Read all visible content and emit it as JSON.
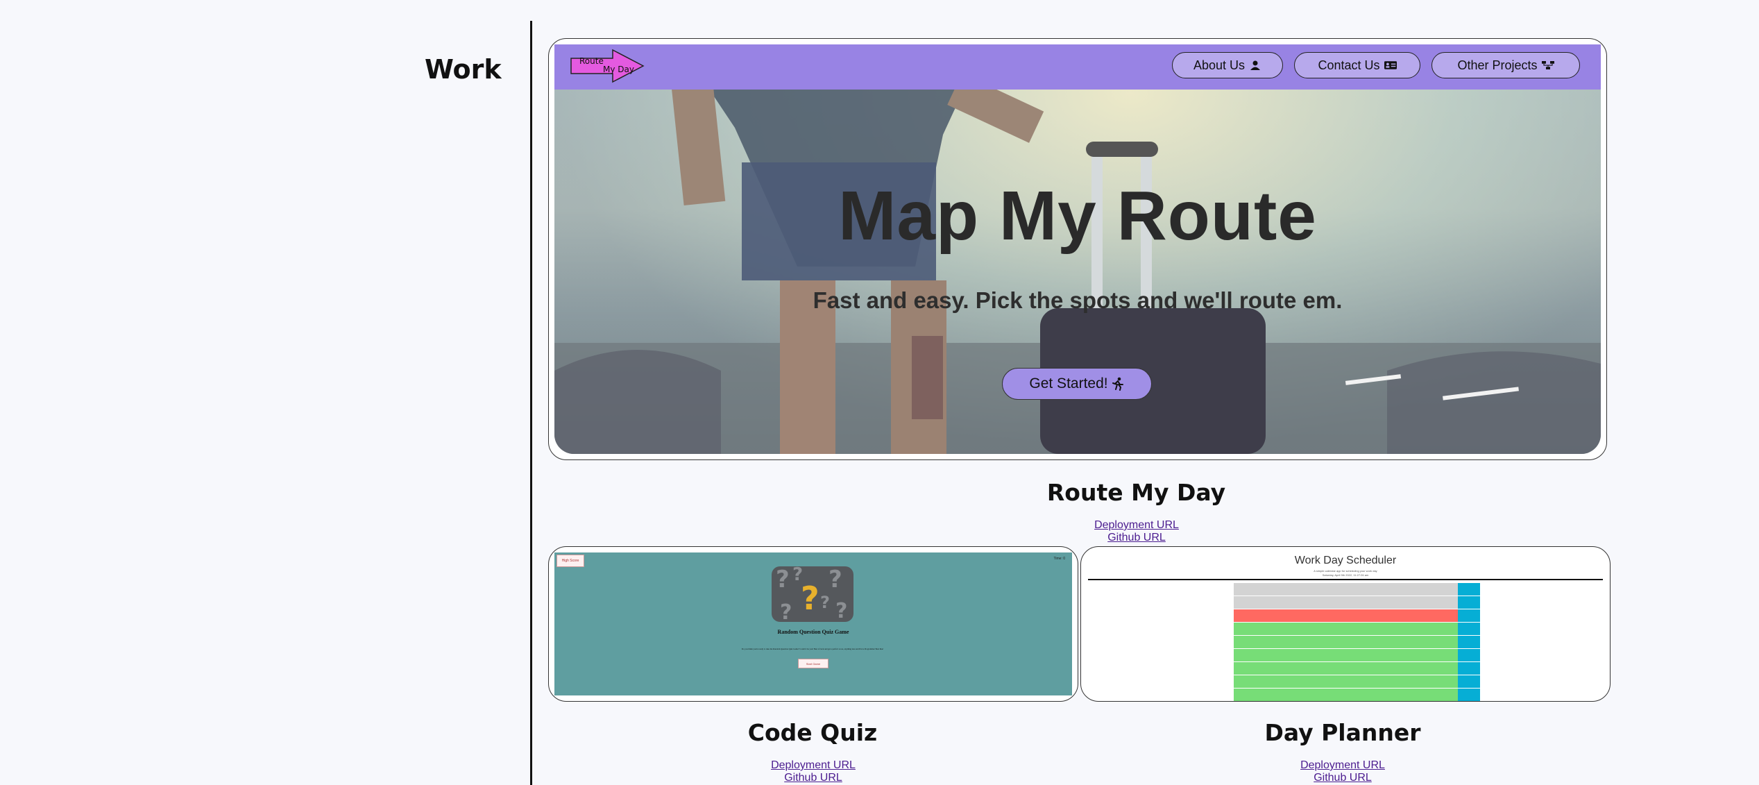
{
  "section": {
    "title": "Work"
  },
  "hero_project": {
    "nav": {
      "logo_text_line1": "Route",
      "logo_text_line2": "My Day",
      "buttons": [
        {
          "label": "About Us",
          "icon": "user-icon"
        },
        {
          "label": "Contact Us",
          "icon": "contact-card-icon"
        },
        {
          "label": "Other Projects",
          "icon": "sitemap-icon"
        }
      ]
    },
    "headline": "Map My Route",
    "subline": "Fast and easy. Pick the spots and we'll route em.",
    "cta_label": "Get Started!",
    "cta_icon": "running-icon",
    "name": "Route My Day",
    "deployment_link": "Deployment URL",
    "github_link": "Github URL"
  },
  "quiz_project": {
    "name": "Code Quiz",
    "screenshot": {
      "corner_btn": "High Score",
      "timer": "Time: 0",
      "heading": "Random Question Quiz Game",
      "body": "Do you think you're ready to take the Random Question Quiz Game? Could it be you! Best of luck and get a perfect score, anything less and Prove Programmer Best like!",
      "start_btn": "Start Game"
    },
    "deployment_link": "Deployment URL",
    "github_link": "Github URL"
  },
  "planner_project": {
    "name": "Day Planner",
    "screenshot": {
      "title": "Work Day Scheduler",
      "subtitle": "A simple calendar app for scheduling your work day",
      "date": "Saturday, April 9th 2022, 11:27:26 am"
    },
    "deployment_link": "Deployment URL",
    "github_link": "Github URL"
  },
  "colors": {
    "nav": "#9883e4",
    "quiz_bg": "#5f9ea0",
    "planner_past": "#d3d3d3",
    "planner_present": "#ff6961",
    "planner_future": "#77dd77",
    "planner_save": "#06aed5"
  }
}
